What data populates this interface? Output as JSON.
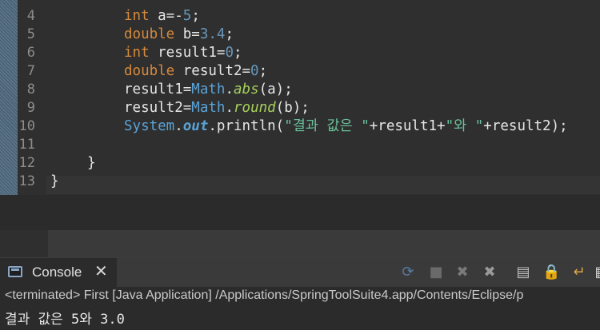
{
  "editor": {
    "line_numbers": [
      "4",
      "5",
      "6",
      "7",
      "8",
      "9",
      "10",
      "11",
      "12",
      "13"
    ],
    "lines": [
      {
        "num": "4",
        "tokens": [
          [
            "kw",
            "int"
          ],
          [
            "plain",
            " a=-"
          ],
          [
            "num",
            "5"
          ],
          [
            "plain",
            ";"
          ]
        ]
      },
      {
        "num": "5",
        "tokens": [
          [
            "kw",
            "double"
          ],
          [
            "plain",
            " b="
          ],
          [
            "num",
            "3.4"
          ],
          [
            "plain",
            ";"
          ]
        ]
      },
      {
        "num": "6",
        "tokens": [
          [
            "kw",
            "int"
          ],
          [
            "plain",
            " result1="
          ],
          [
            "num",
            "0"
          ],
          [
            "plain",
            ";"
          ]
        ]
      },
      {
        "num": "7",
        "tokens": [
          [
            "kw",
            "double"
          ],
          [
            "plain",
            " result2="
          ],
          [
            "num",
            "0"
          ],
          [
            "plain",
            ";"
          ]
        ]
      },
      {
        "num": "8",
        "tokens": [
          [
            "plain",
            "result1="
          ],
          [
            "cls",
            "Math"
          ],
          [
            "plain",
            "."
          ],
          [
            "meth",
            "abs"
          ],
          [
            "plain",
            "(a);"
          ]
        ]
      },
      {
        "num": "9",
        "tokens": [
          [
            "plain",
            "result2="
          ],
          [
            "cls",
            "Math"
          ],
          [
            "plain",
            "."
          ],
          [
            "meth",
            "round"
          ],
          [
            "plain",
            "(b);"
          ]
        ]
      },
      {
        "num": "10",
        "tokens": [
          [
            "cls",
            "System"
          ],
          [
            "plain",
            "."
          ],
          [
            "field",
            "out"
          ],
          [
            "plain",
            ".println("
          ],
          [
            "str",
            "\"결과 값은 \""
          ],
          [
            "plain",
            "+result1+"
          ],
          [
            "str",
            "\"와 \""
          ],
          [
            "plain",
            "+result2);"
          ]
        ]
      },
      {
        "num": "11",
        "tokens": []
      },
      {
        "num": "12",
        "tokens": [
          [
            "plain",
            "}"
          ]
        ]
      },
      {
        "num": "13",
        "tokens": [
          [
            "plain",
            "}"
          ]
        ]
      }
    ]
  },
  "console": {
    "tab_label": "Console",
    "close_glyph": "✕",
    "status": "<terminated> First [Java Application] /Applications/SpringToolSuite4.app/Contents/Eclipse/p",
    "output": "결과 값은 5와 3.0",
    "toolbar": [
      {
        "name": "terminate-relaunch-icon",
        "glyph": "⟳",
        "color": "#5a7aa0"
      },
      {
        "name": "terminate-icon",
        "glyph": "■",
        "color": "#6a6a6a"
      },
      {
        "name": "remove-launch-icon",
        "glyph": "✖",
        "color": "#7a7a7a"
      },
      {
        "name": "remove-all-icon",
        "glyph": "✖",
        "color": "#9a9a9a"
      },
      {
        "name": "clear-console-icon",
        "glyph": "▤",
        "color": "#c0c0c0"
      },
      {
        "name": "scroll-lock-icon",
        "glyph": "🔒",
        "color": "#d8b04a"
      },
      {
        "name": "word-wrap-icon",
        "glyph": "↵",
        "color": "#d8a840"
      },
      {
        "name": "pin-console-icon",
        "glyph": "▦",
        "color": "#cfcfcf"
      }
    ]
  }
}
